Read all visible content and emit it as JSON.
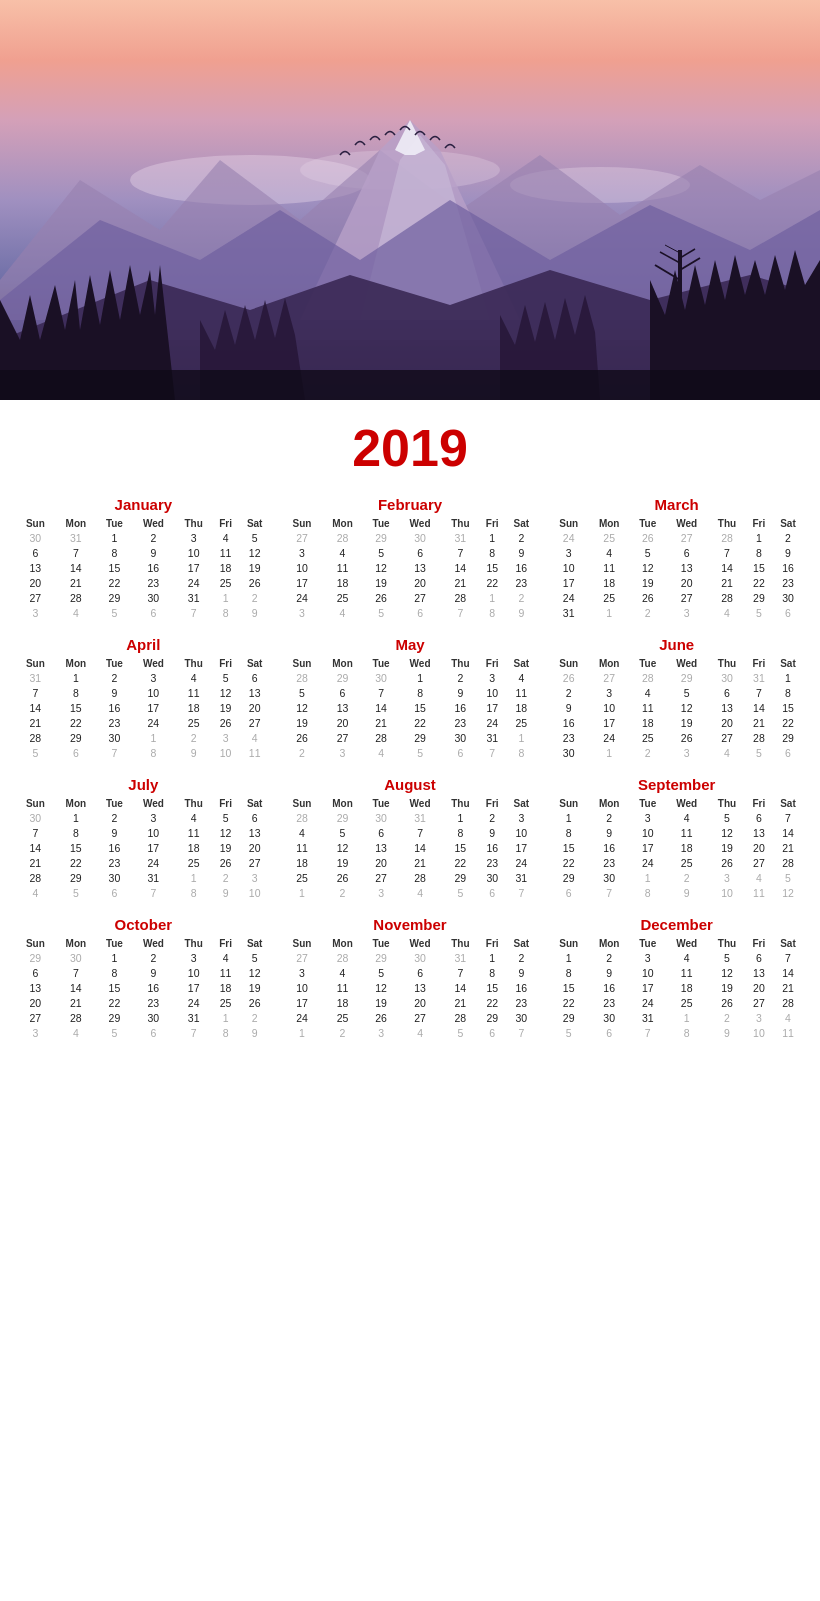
{
  "year": "2019",
  "months": [
    {
      "name": "January",
      "weeks": [
        [
          "30",
          "31",
          "1",
          "2",
          "3",
          "4",
          "5"
        ],
        [
          "6",
          "7",
          "8",
          "9",
          "10",
          "11",
          "12"
        ],
        [
          "13",
          "14",
          "15",
          "16",
          "17",
          "18",
          "19"
        ],
        [
          "20",
          "21",
          "22",
          "23",
          "24",
          "25",
          "26"
        ],
        [
          "27",
          "28",
          "29",
          "30",
          "31",
          "1",
          "2"
        ],
        [
          "3",
          "4",
          "5",
          "6",
          "7",
          "8",
          "9"
        ]
      ],
      "otherMonthStart": 2,
      "otherMonthEnd": [
        2,
        6
      ],
      "otherRows": [
        0,
        5
      ]
    },
    {
      "name": "February",
      "weeks": [
        [
          "27",
          "28",
          "29",
          "30",
          "31",
          "1",
          "2"
        ],
        [
          "3",
          "4",
          "5",
          "6",
          "7",
          "8",
          "9"
        ],
        [
          "10",
          "11",
          "12",
          "13",
          "14",
          "15",
          "16"
        ],
        [
          "17",
          "18",
          "19",
          "20",
          "21",
          "22",
          "23"
        ],
        [
          "24",
          "25",
          "26",
          "27",
          "28",
          "1",
          "2"
        ],
        [
          "3",
          "4",
          "5",
          "6",
          "7",
          "8",
          "9"
        ]
      ]
    },
    {
      "name": "March",
      "weeks": [
        [
          "24",
          "25",
          "26",
          "27",
          "28",
          "1",
          "2"
        ],
        [
          "3",
          "4",
          "5",
          "6",
          "7",
          "8",
          "9"
        ],
        [
          "10",
          "11",
          "12",
          "13",
          "14",
          "15",
          "16"
        ],
        [
          "17",
          "18",
          "19",
          "20",
          "21",
          "22",
          "23"
        ],
        [
          "24",
          "25",
          "26",
          "27",
          "28",
          "29",
          "30"
        ],
        [
          "31",
          "1",
          "2",
          "3",
          "4",
          "5",
          "6"
        ]
      ]
    },
    {
      "name": "April",
      "weeks": [
        [
          "31",
          "1",
          "2",
          "3",
          "4",
          "5",
          "6"
        ],
        [
          "7",
          "8",
          "9",
          "10",
          "11",
          "12",
          "13"
        ],
        [
          "14",
          "15",
          "16",
          "17",
          "18",
          "19",
          "20"
        ],
        [
          "21",
          "22",
          "23",
          "24",
          "25",
          "26",
          "27"
        ],
        [
          "28",
          "29",
          "30",
          "1",
          "2",
          "3",
          "4"
        ],
        [
          "5",
          "6",
          "7",
          "8",
          "9",
          "10",
          "11"
        ]
      ]
    },
    {
      "name": "May",
      "weeks": [
        [
          "28",
          "29",
          "30",
          "1",
          "2",
          "3",
          "4"
        ],
        [
          "5",
          "6",
          "7",
          "8",
          "9",
          "10",
          "11"
        ],
        [
          "12",
          "13",
          "14",
          "15",
          "16",
          "17",
          "18"
        ],
        [
          "19",
          "20",
          "21",
          "22",
          "23",
          "24",
          "25"
        ],
        [
          "26",
          "27",
          "28",
          "29",
          "30",
          "31",
          "1"
        ],
        [
          "2",
          "3",
          "4",
          "5",
          "6",
          "7",
          "8"
        ]
      ]
    },
    {
      "name": "June",
      "weeks": [
        [
          "26",
          "27",
          "28",
          "29",
          "30",
          "31",
          "1"
        ],
        [
          "2",
          "3",
          "4",
          "5",
          "6",
          "7",
          "8"
        ],
        [
          "9",
          "10",
          "11",
          "12",
          "13",
          "14",
          "15"
        ],
        [
          "16",
          "17",
          "18",
          "19",
          "20",
          "21",
          "22"
        ],
        [
          "23",
          "24",
          "25",
          "26",
          "27",
          "28",
          "29"
        ],
        [
          "30",
          "1",
          "2",
          "3",
          "4",
          "5",
          "6"
        ]
      ]
    },
    {
      "name": "July",
      "weeks": [
        [
          "30",
          "1",
          "2",
          "3",
          "4",
          "5",
          "6"
        ],
        [
          "7",
          "8",
          "9",
          "10",
          "11",
          "12",
          "13"
        ],
        [
          "14",
          "15",
          "16",
          "17",
          "18",
          "19",
          "20"
        ],
        [
          "21",
          "22",
          "23",
          "24",
          "25",
          "26",
          "27"
        ],
        [
          "28",
          "29",
          "30",
          "31",
          "1",
          "2",
          "3"
        ],
        [
          "4",
          "5",
          "6",
          "7",
          "8",
          "9",
          "10"
        ]
      ]
    },
    {
      "name": "August",
      "weeks": [
        [
          "28",
          "29",
          "30",
          "31",
          "1",
          "2",
          "3"
        ],
        [
          "4",
          "5",
          "6",
          "7",
          "8",
          "9",
          "10"
        ],
        [
          "11",
          "12",
          "13",
          "14",
          "15",
          "16",
          "17"
        ],
        [
          "18",
          "19",
          "20",
          "21",
          "22",
          "23",
          "24"
        ],
        [
          "25",
          "26",
          "27",
          "28",
          "29",
          "30",
          "31"
        ],
        [
          "1",
          "2",
          "3",
          "4",
          "5",
          "6",
          "7"
        ]
      ]
    },
    {
      "name": "September",
      "weeks": [
        [
          "1",
          "2",
          "3",
          "4",
          "5",
          "6",
          "7"
        ],
        [
          "8",
          "9",
          "10",
          "11",
          "12",
          "13",
          "14"
        ],
        [
          "15",
          "16",
          "17",
          "18",
          "19",
          "20",
          "21"
        ],
        [
          "22",
          "23",
          "24",
          "25",
          "26",
          "27",
          "28"
        ],
        [
          "29",
          "30",
          "1",
          "2",
          "3",
          "4",
          "5"
        ],
        [
          "6",
          "7",
          "8",
          "9",
          "10",
          "11",
          "12"
        ]
      ]
    },
    {
      "name": "October",
      "weeks": [
        [
          "29",
          "30",
          "1",
          "2",
          "3",
          "4",
          "5"
        ],
        [
          "6",
          "7",
          "8",
          "9",
          "10",
          "11",
          "12"
        ],
        [
          "13",
          "14",
          "15",
          "16",
          "17",
          "18",
          "19"
        ],
        [
          "20",
          "21",
          "22",
          "23",
          "24",
          "25",
          "26"
        ],
        [
          "27",
          "28",
          "29",
          "30",
          "31",
          "1",
          "2"
        ],
        [
          "3",
          "4",
          "5",
          "6",
          "7",
          "8",
          "9"
        ]
      ]
    },
    {
      "name": "November",
      "weeks": [
        [
          "27",
          "28",
          "29",
          "30",
          "31",
          "1",
          "2"
        ],
        [
          "3",
          "4",
          "5",
          "6",
          "7",
          "8",
          "9"
        ],
        [
          "10",
          "11",
          "12",
          "13",
          "14",
          "15",
          "16"
        ],
        [
          "17",
          "18",
          "19",
          "20",
          "21",
          "22",
          "23"
        ],
        [
          "24",
          "25",
          "26",
          "27",
          "28",
          "29",
          "30"
        ],
        [
          "1",
          "2",
          "3",
          "4",
          "5",
          "6",
          "7"
        ]
      ]
    },
    {
      "name": "December",
      "weeks": [
        [
          "1",
          "2",
          "3",
          "4",
          "5",
          "6",
          "7"
        ],
        [
          "8",
          "9",
          "10",
          "11",
          "12",
          "13",
          "14"
        ],
        [
          "15",
          "16",
          "17",
          "18",
          "19",
          "20",
          "21"
        ],
        [
          "22",
          "23",
          "24",
          "25",
          "26",
          "27",
          "28"
        ],
        [
          "29",
          "30",
          "31",
          "1",
          "2",
          "3",
          "4"
        ],
        [
          "5",
          "6",
          "7",
          "8",
          "9",
          "10",
          "11"
        ]
      ]
    }
  ],
  "dayHeaders": [
    "Sun",
    "Mon",
    "Tue",
    "Wed",
    "Thu",
    "Fri",
    "Sat"
  ],
  "otherMonthCells": {
    "January": {
      "row0": [
        0,
        1
      ],
      "row4": [
        5,
        6
      ],
      "row5": [
        0,
        1,
        2,
        3,
        4,
        5,
        6
      ]
    },
    "February": {
      "row0": [
        0,
        1,
        2,
        3,
        4
      ],
      "row4": [
        5,
        6
      ],
      "row5": [
        0,
        1,
        2,
        3,
        4,
        5,
        6
      ]
    },
    "March": {
      "row0": [
        0,
        1,
        2,
        3,
        4
      ],
      "row5": [
        1,
        2,
        3,
        4,
        5,
        6
      ]
    },
    "April": {
      "row0": [
        0
      ],
      "row4": [
        3,
        4,
        5,
        6
      ],
      "row5": [
        0,
        1,
        2,
        3,
        4,
        5,
        6
      ]
    },
    "May": {
      "row0": [
        0,
        1,
        2
      ],
      "row4": [
        6
      ],
      "row5": [
        0,
        1,
        2,
        3,
        4,
        5,
        6
      ]
    },
    "June": {
      "row0": [
        0,
        1,
        2,
        3,
        4,
        5
      ],
      "row5": [
        1,
        2,
        3,
        4,
        5,
        6
      ]
    },
    "July": {
      "row0": [
        0
      ],
      "row4": [
        4,
        5,
        6
      ],
      "row5": [
        0,
        1,
        2,
        3,
        4,
        5,
        6
      ]
    },
    "August": {
      "row0": [
        0,
        1,
        2,
        3
      ],
      "row5": [
        0,
        1,
        2,
        3,
        4,
        5,
        6
      ]
    },
    "September": {
      "row4": [
        2,
        3,
        4,
        5,
        6
      ],
      "row5": [
        0,
        1,
        2,
        3,
        4,
        5,
        6
      ]
    },
    "October": {
      "row0": [
        0,
        1
      ],
      "row4": [
        5,
        6
      ],
      "row5": [
        0,
        1,
        2,
        3,
        4,
        5,
        6
      ]
    },
    "November": {
      "row0": [
        0,
        1,
        2,
        3,
        4
      ],
      "row5": [
        0,
        1,
        2,
        3,
        4,
        5,
        6
      ]
    },
    "December": {
      "row4": [
        3,
        4,
        5,
        6
      ],
      "row5": [
        0,
        1,
        2,
        3,
        4,
        5,
        6
      ]
    }
  }
}
